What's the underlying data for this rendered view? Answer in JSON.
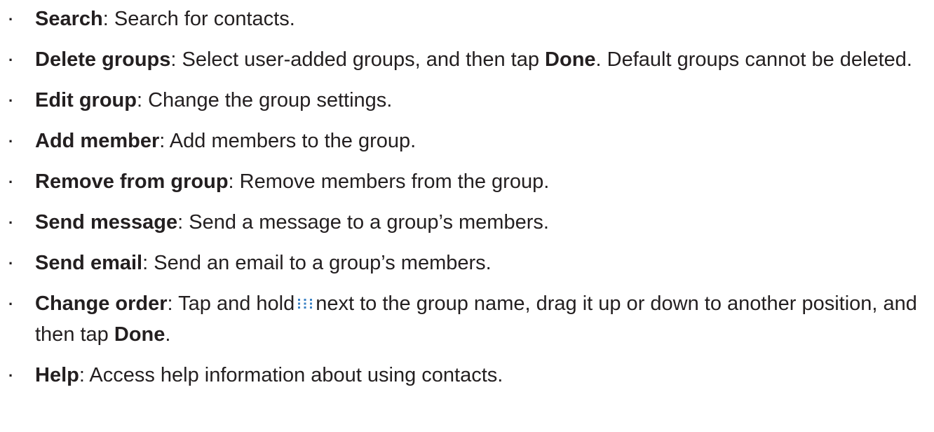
{
  "items": [
    {
      "term": "Search",
      "sep": ": ",
      "text": "Search for contacts."
    },
    {
      "term": "Delete groups",
      "sep": ": ",
      "text1": "Select user-added groups, and then tap ",
      "bold": "Done",
      "text2": ". Default groups cannot be deleted."
    },
    {
      "term": "Edit group",
      "sep": ": ",
      "text": "Change the group settings."
    },
    {
      "term": "Add member",
      "sep": ": ",
      "text": "Add members to the group."
    },
    {
      "term": "Remove from group",
      "sep": ": ",
      "text": "Remove members from the group."
    },
    {
      "term": "Send message",
      "sep": ": ",
      "text": "Send a message to a group’s members."
    },
    {
      "term": "Send email",
      "sep": ": ",
      "text": "Send an email to a group’s members."
    },
    {
      "term": "Change order",
      "sep": ": ",
      "text1": "Tap and hold",
      "icon": "reorder-grip-icon",
      "text2": "next to the group name, drag it up or down to another position, and then tap ",
      "bold": "Done",
      "text3": "."
    },
    {
      "term": "Help",
      "sep": ": ",
      "text": "Access help information about using contacts."
    }
  ],
  "colors": {
    "text": "#231f20",
    "icon": "#3b82c4"
  }
}
